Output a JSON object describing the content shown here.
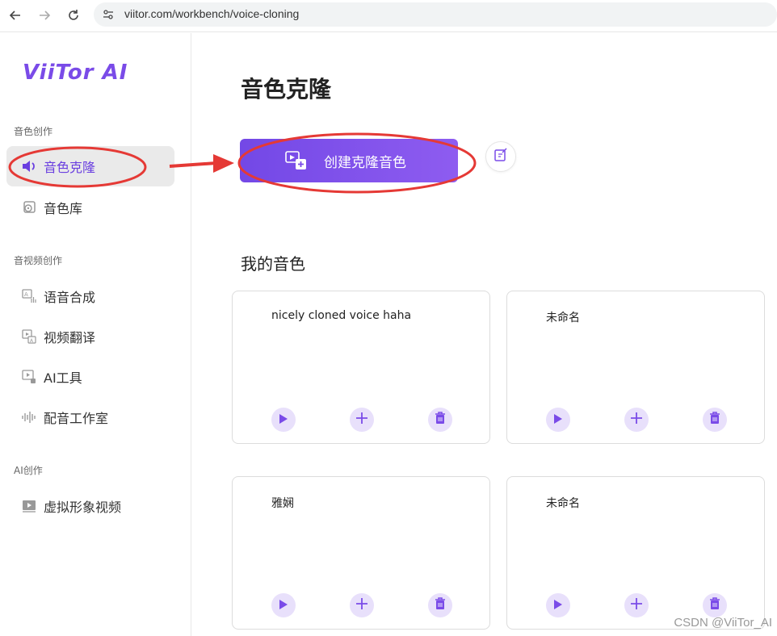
{
  "browser": {
    "url": "viitor.com/workbench/voice-cloning"
  },
  "sidebar": {
    "logo": "ViiTor AI",
    "sections": [
      {
        "label": "音色创作",
        "items": [
          {
            "label": "音色克隆",
            "icon": "speaker-icon",
            "active": true
          },
          {
            "label": "音色库",
            "icon": "voice-library-icon"
          }
        ]
      },
      {
        "label": "音视频创作",
        "items": [
          {
            "label": "语音合成",
            "icon": "tts-icon"
          },
          {
            "label": "视频翻译",
            "icon": "video-translate-icon"
          },
          {
            "label": "AI工具",
            "icon": "ai-tools-icon"
          },
          {
            "label": "配音工作室",
            "icon": "waveform-icon"
          }
        ]
      },
      {
        "label": "AI创作",
        "items": [
          {
            "label": "虚拟形象视频",
            "icon": "avatar-video-icon"
          }
        ]
      }
    ]
  },
  "main": {
    "title": "音色克隆",
    "create_button": "创建克隆音色",
    "my_voices_title": "我的音色",
    "voices": [
      {
        "name": "nicely cloned voice haha"
      },
      {
        "name": "未命名"
      },
      {
        "name": "雅娴"
      },
      {
        "name": "未命名"
      }
    ]
  },
  "colors": {
    "accent": "#7a4be8",
    "annotation": "#e53935"
  },
  "watermark": "CSDN @ViiTor_AI"
}
